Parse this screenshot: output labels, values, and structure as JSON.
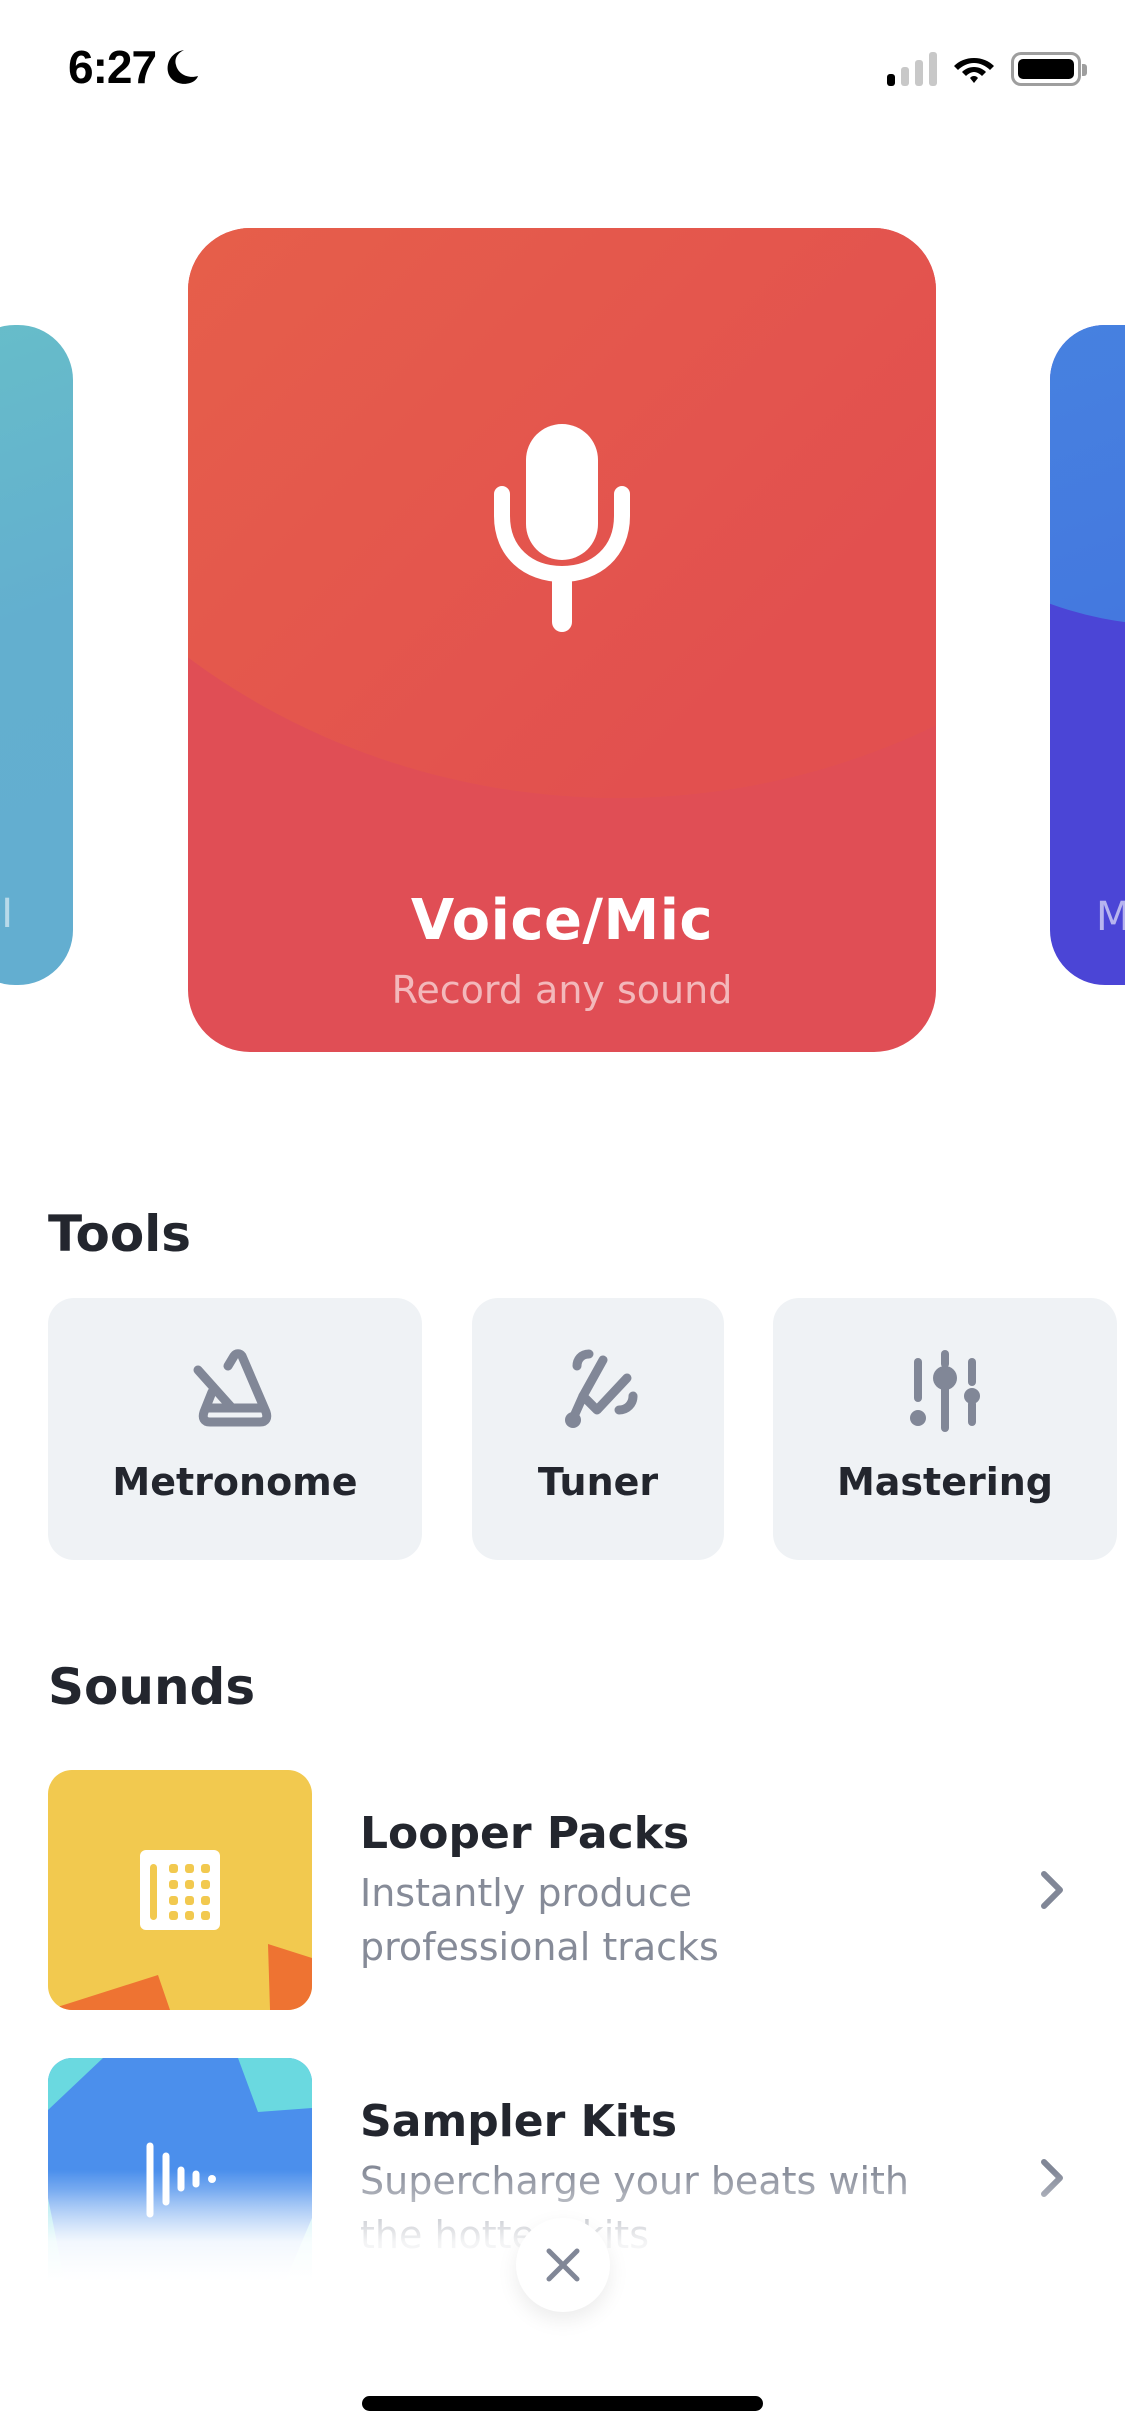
{
  "status_bar": {
    "time": "6:27",
    "focus_icon": "moon-icon",
    "signal_bars_active": 1,
    "signal_bars_total": 4,
    "wifi_icon": "wifi-icon",
    "battery_icon": "battery-icon"
  },
  "carousel": {
    "active_index": 1,
    "cards": [
      {
        "title": "",
        "subtitle": "",
        "peek_label": "I",
        "icon": "unknown",
        "colors": [
          "#67bdc9",
          "#63aed0"
        ]
      },
      {
        "title": "Voice/Mic",
        "subtitle": "Record any sound",
        "icon": "microphone-icon",
        "colors": [
          "#ec7043",
          "#e04e55"
        ]
      },
      {
        "title": "",
        "subtitle": "",
        "peek_label": "M",
        "icon": "unknown",
        "colors": [
          "#4a8fe0",
          "#4b45d6"
        ]
      }
    ]
  },
  "tools": {
    "heading": "Tools",
    "items": [
      {
        "label": "Metronome",
        "icon": "metronome-icon"
      },
      {
        "label": "Tuner",
        "icon": "tuning-fork-icon"
      },
      {
        "label": "Mastering",
        "icon": "sliders-icon"
      }
    ]
  },
  "sounds": {
    "heading": "Sounds",
    "items": [
      {
        "title": "Looper Packs",
        "description_line1": "Instantly produce",
        "description_line2": "professional tracks",
        "icon": "drum-pad-icon",
        "thumb_color": "#f2c94f",
        "accent_color": "#ee7332"
      },
      {
        "title": "Sampler Kits",
        "description_line1": "Supercharge your beats with",
        "description_line2": "the hottest kits",
        "icon": "sound-wave-icon",
        "thumb_color": "#4b8fec",
        "accent_color": "#6ad9e0"
      }
    ]
  },
  "close_button": {
    "icon": "close-icon"
  },
  "colors": {
    "text_primary": "#23262e",
    "text_secondary": "#868b98",
    "icon_gray": "#818797",
    "tool_card_bg": "#eff2f5"
  }
}
